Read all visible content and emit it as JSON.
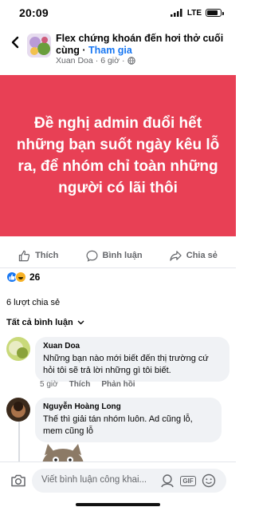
{
  "status_bar": {
    "time": "20:09",
    "network": "LTE"
  },
  "header": {
    "group_name": "Flex chứng khoán đến hơi thở cuối cùng",
    "separator": " · ",
    "join_label": "Tham gia",
    "author": "Xuan Doa",
    "time_ago": "6 giờ",
    "dot": "·"
  },
  "post": {
    "text": "Đề nghị admin đuổi hết những bạn suốt ngày kêu lỗ ra, để nhóm chỉ toàn những người có lãi thôi",
    "background_color": "#e84055"
  },
  "actions": {
    "like": "Thích",
    "comment": "Bình luận",
    "share": "Chia sẻ"
  },
  "reactions": {
    "count": "26",
    "types": [
      "like-icon",
      "haha-icon"
    ]
  },
  "shares": {
    "text": "6 lượt chia sẻ"
  },
  "comments_filter": {
    "label": "Tất cả bình luận"
  },
  "comments": [
    {
      "name": "Xuan Doa",
      "text": "Những bạn nào mới biết đến thị trường cứ hỏi tôi sẽ trả lời những gì tôi biết.",
      "time": "5 giờ",
      "like": "Thích",
      "reply": "Phản hồi"
    },
    {
      "name": "Nguyễn Hoàng Long",
      "text": "Thế thì giải tán nhóm luôn. Ad cũng lỗ, mem cũng lỗ",
      "time": "",
      "like": "",
      "reply": ""
    }
  ],
  "composer": {
    "placeholder": "Viết bình luận công khai...",
    "gif_label": "GIF"
  },
  "colors": {
    "accent": "#1877f2",
    "muted_text": "#65676b",
    "bubble": "#f0f2f5"
  }
}
